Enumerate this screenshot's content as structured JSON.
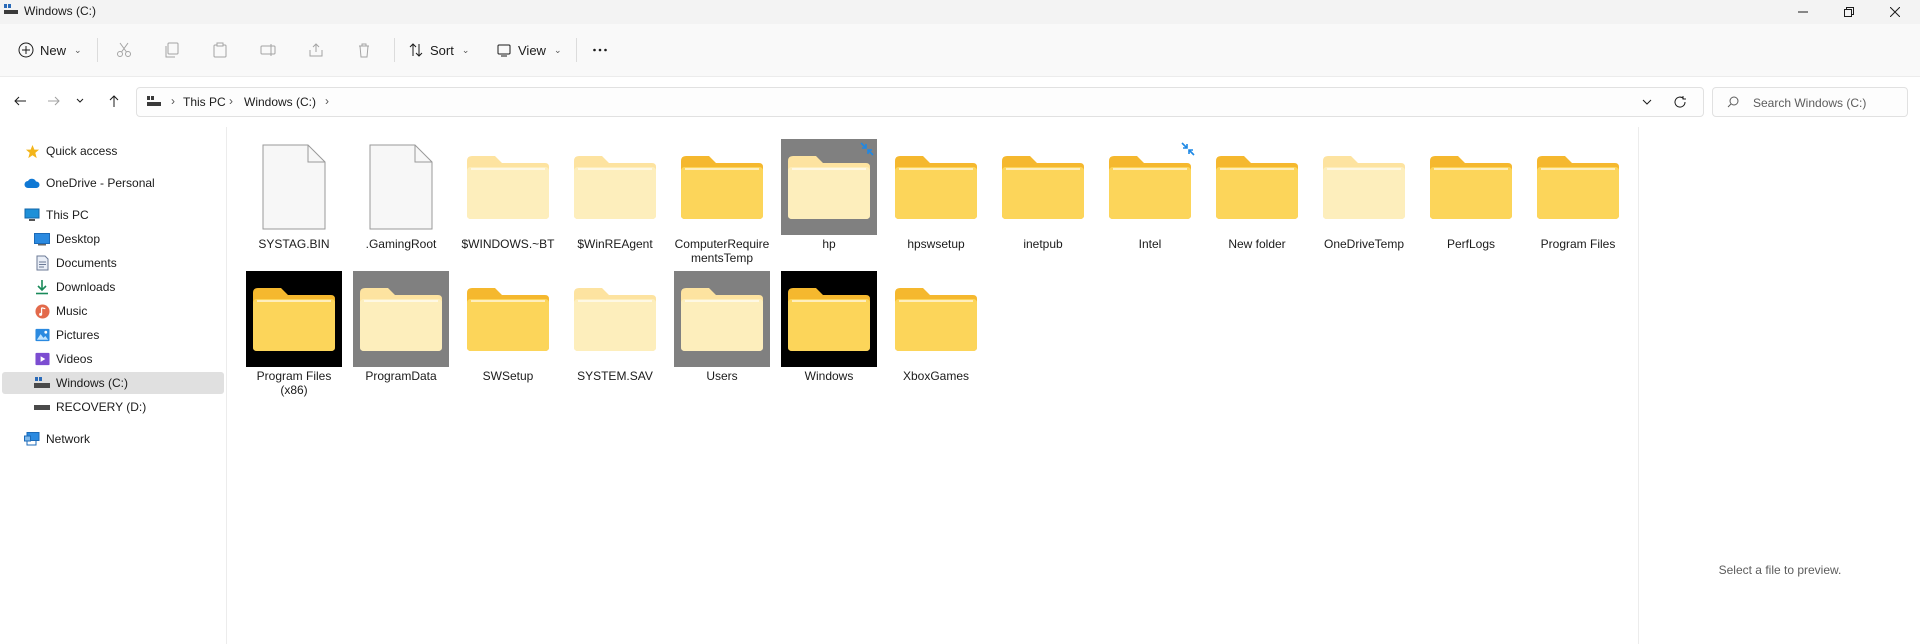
{
  "window": {
    "title": "Windows (C:)"
  },
  "toolbar": {
    "new_label": "New",
    "sort_label": "Sort",
    "view_label": "View"
  },
  "address": {
    "crumbs": [
      "This PC",
      "Windows (C:)"
    ]
  },
  "search": {
    "placeholder": "Search Windows (C:)"
  },
  "sidebar": {
    "items": [
      {
        "label": "Quick access",
        "icon": "star-icon"
      },
      {
        "label": "OneDrive - Personal",
        "icon": "cloud-icon"
      },
      {
        "label": "This PC",
        "icon": "pc-icon"
      },
      {
        "label": "Desktop",
        "icon": "desktop-icon"
      },
      {
        "label": "Documents",
        "icon": "documents-icon"
      },
      {
        "label": "Downloads",
        "icon": "download-icon"
      },
      {
        "label": "Music",
        "icon": "music-icon"
      },
      {
        "label": "Pictures",
        "icon": "pictures-icon"
      },
      {
        "label": "Videos",
        "icon": "videos-icon"
      },
      {
        "label": "Windows (C:)",
        "icon": "drive-icon",
        "selected": true
      },
      {
        "label": "RECOVERY (D:)",
        "icon": "drive-icon"
      },
      {
        "label": "Network",
        "icon": "network-icon"
      }
    ]
  },
  "files": [
    {
      "name": "SYSTAG.BIN",
      "kind": "file"
    },
    {
      "name": ".GamingRoot",
      "kind": "file"
    },
    {
      "name": "$WINDOWS.~BT",
      "kind": "folder-hidden"
    },
    {
      "name": "$WinREAgent",
      "kind": "folder-hidden"
    },
    {
      "name": "ComputerRequirementsTemp",
      "kind": "folder"
    },
    {
      "name": "hp",
      "kind": "folder-hidden",
      "bg": "grey",
      "pinned": true
    },
    {
      "name": "hpswsetup",
      "kind": "folder"
    },
    {
      "name": "inetpub",
      "kind": "folder"
    },
    {
      "name": "Intel",
      "kind": "folder",
      "pinned": true
    },
    {
      "name": "New folder",
      "kind": "folder"
    },
    {
      "name": "OneDriveTemp",
      "kind": "folder-hidden"
    },
    {
      "name": "PerfLogs",
      "kind": "folder"
    },
    {
      "name": "Program Files",
      "kind": "folder"
    },
    {
      "name": "Program Files (x86)",
      "kind": "folder",
      "bg": "black"
    },
    {
      "name": "ProgramData",
      "kind": "folder-hidden",
      "bg": "grey"
    },
    {
      "name": "SWSetup",
      "kind": "folder"
    },
    {
      "name": "SYSTEM.SAV",
      "kind": "folder-hidden"
    },
    {
      "name": "Users",
      "kind": "folder-hidden",
      "bg": "grey"
    },
    {
      "name": "Windows",
      "kind": "folder",
      "bg": "black"
    },
    {
      "name": "XboxGames",
      "kind": "folder"
    }
  ],
  "preview": {
    "message": "Select a file to preview."
  },
  "colors": {
    "folder": "#f8c33c",
    "folder_light": "#fde9a4",
    "accent": "#0067c0"
  }
}
